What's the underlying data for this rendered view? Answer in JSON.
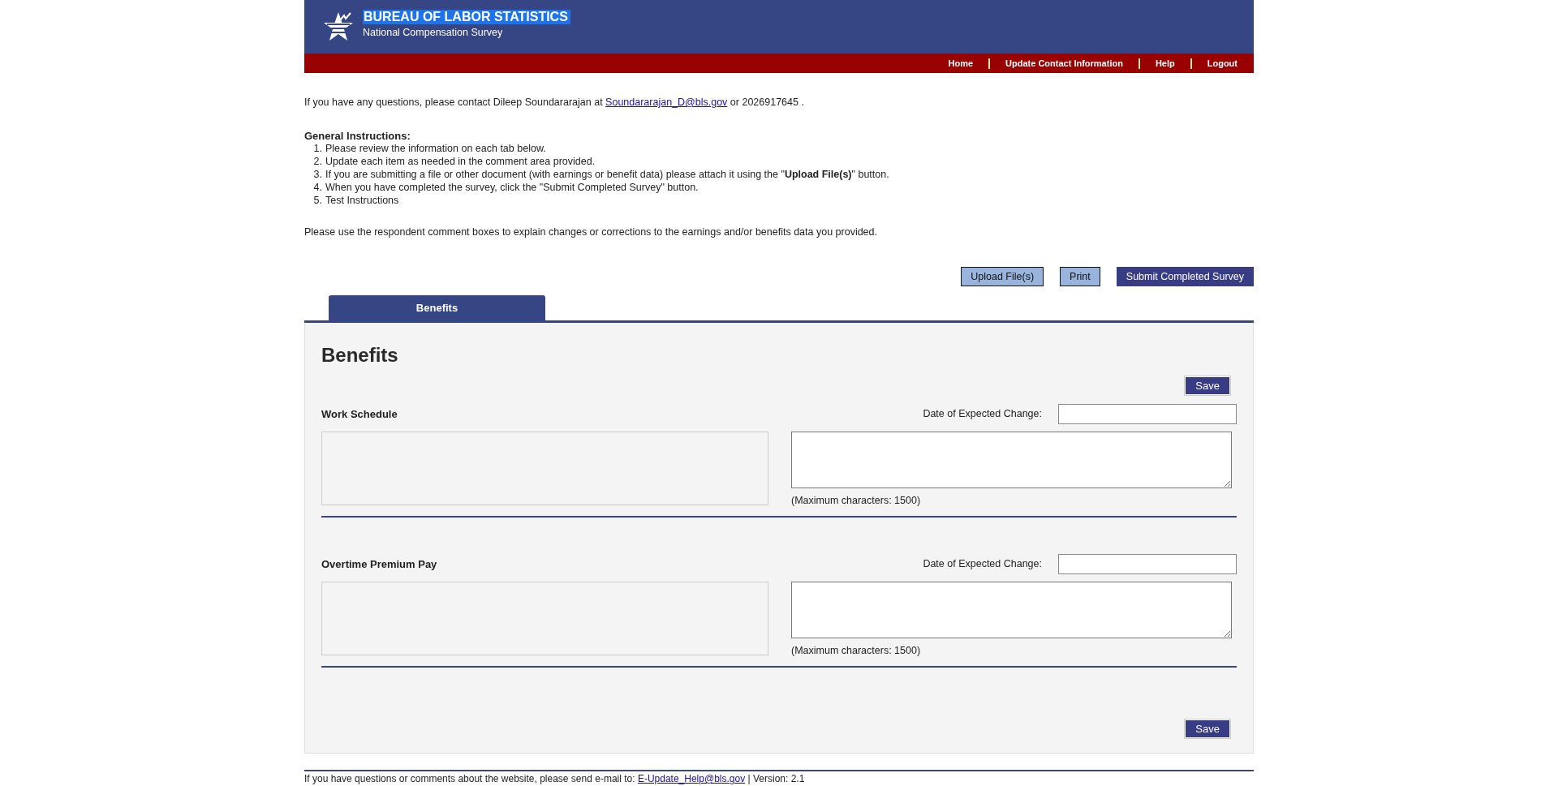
{
  "header": {
    "title": "BUREAU OF LABOR STATISTICS",
    "subtitle": "National Compensation Survey"
  },
  "nav": [
    {
      "label": "Home"
    },
    {
      "label": "Update Contact Information"
    },
    {
      "label": "Help"
    },
    {
      "label": "Logout"
    }
  ],
  "contact": {
    "before": "If you have any questions, please contact Dileep Soundararajan at",
    "email": "Soundararajan_D@bls.gov",
    "after": "or 2026917645 ."
  },
  "instructions": {
    "heading": "General Instructions:",
    "items": [
      {
        "marker": "1.",
        "text": "Please review the information on each tab below."
      },
      {
        "marker": "2.",
        "text": "Update each item as needed in the comment area provided."
      },
      {
        "marker": "3.",
        "text": "If you are submitting a file or other document (with earnings or benefit data) please attach it using the \"**Upload File(s)**\" button."
      },
      {
        "marker": "4.",
        "text": "When you have completed the survey, click the \"Submit Completed Survey\" button."
      },
      {
        "marker": "5.",
        "text": "Test Instructions"
      }
    ]
  },
  "note": "Please use the respondent comment boxes to explain changes or corrections to the earnings and/or benefits data you provided.",
  "actions": [
    {
      "label": "Upload File(s)",
      "kind": "secondary"
    },
    {
      "label": "Print",
      "kind": "secondary"
    },
    {
      "label": "Submit Completed Survey",
      "kind": "primary"
    }
  ],
  "tabs": [
    {
      "label": "Benefits",
      "selected": true
    }
  ],
  "panel": {
    "title": "Benefits",
    "save_top": "Save",
    "sections": [
      {
        "label": "Work Schedule",
        "date_label": "Date of Expected Change:",
        "max_note": "(Maximum characters: 1500)"
      },
      {
        "label": "Overtime Premium Pay",
        "date_label": "Date of Expected Change:",
        "max_note": "(Maximum characters: 1500)"
      }
    ],
    "save_bottom": "Save"
  },
  "footer": {
    "text": "If you have questions or comments about the website, please send e-mail to:",
    "email": "E-Update_Help@bls.gov",
    "after": "| Version: 2.1"
  }
}
